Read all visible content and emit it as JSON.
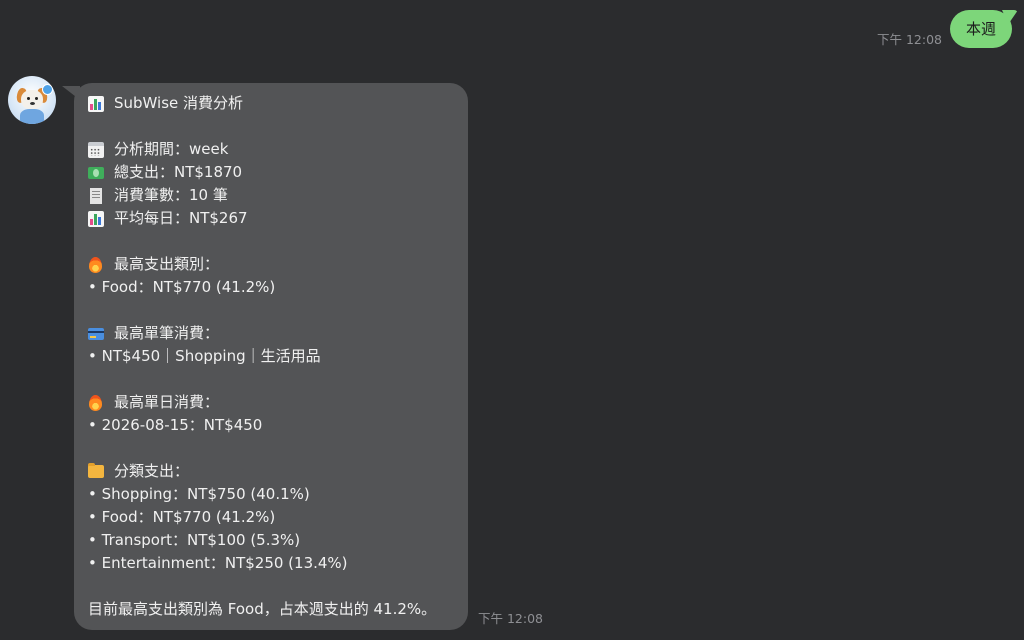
{
  "outgoing": {
    "time": "下午 12:08",
    "text": "本週"
  },
  "incoming": {
    "time": "下午 12:08",
    "title": "SubWise 消費分析",
    "period": "分析期間：week",
    "total": "總支出：NT$1870",
    "count": "消費筆數：10 筆",
    "avg": "平均每日：NT$267",
    "top_category_label": "最高支出類別：",
    "top_category_item": "• Food：NT$770 (41.2%)",
    "top_single_label": "最高單筆消費：",
    "top_single_item": "• NT$450｜Shopping｜生活用品",
    "top_day_label": "最高單日消費：",
    "top_day_item": "• 2026-08-15：NT$450",
    "categories_label": "分類支出：",
    "categories": [
      "• Shopping：NT$750 (40.1%)",
      "• Food：NT$770 (41.2%)",
      "• Transport：NT$100 (5.3%)",
      "• Entertainment：NT$250 (13.4%)"
    ],
    "summary": "目前最高支出類別為 Food，占本週支出的 41.2%。"
  },
  "icons": {
    "title": "bar-chart-icon",
    "period": "calendar-icon",
    "total": "money-icon",
    "count": "receipt-icon",
    "avg": "bar-chart-icon",
    "top_category": "fire-icon",
    "top_single": "credit-card-icon",
    "top_day": "fire-icon",
    "categories": "folder-icon"
  },
  "colors": {
    "background": "#2b2c2e",
    "outgoing_bubble": "#7dd67a",
    "incoming_bubble": "#535456",
    "time_text": "#8e8f93"
  }
}
